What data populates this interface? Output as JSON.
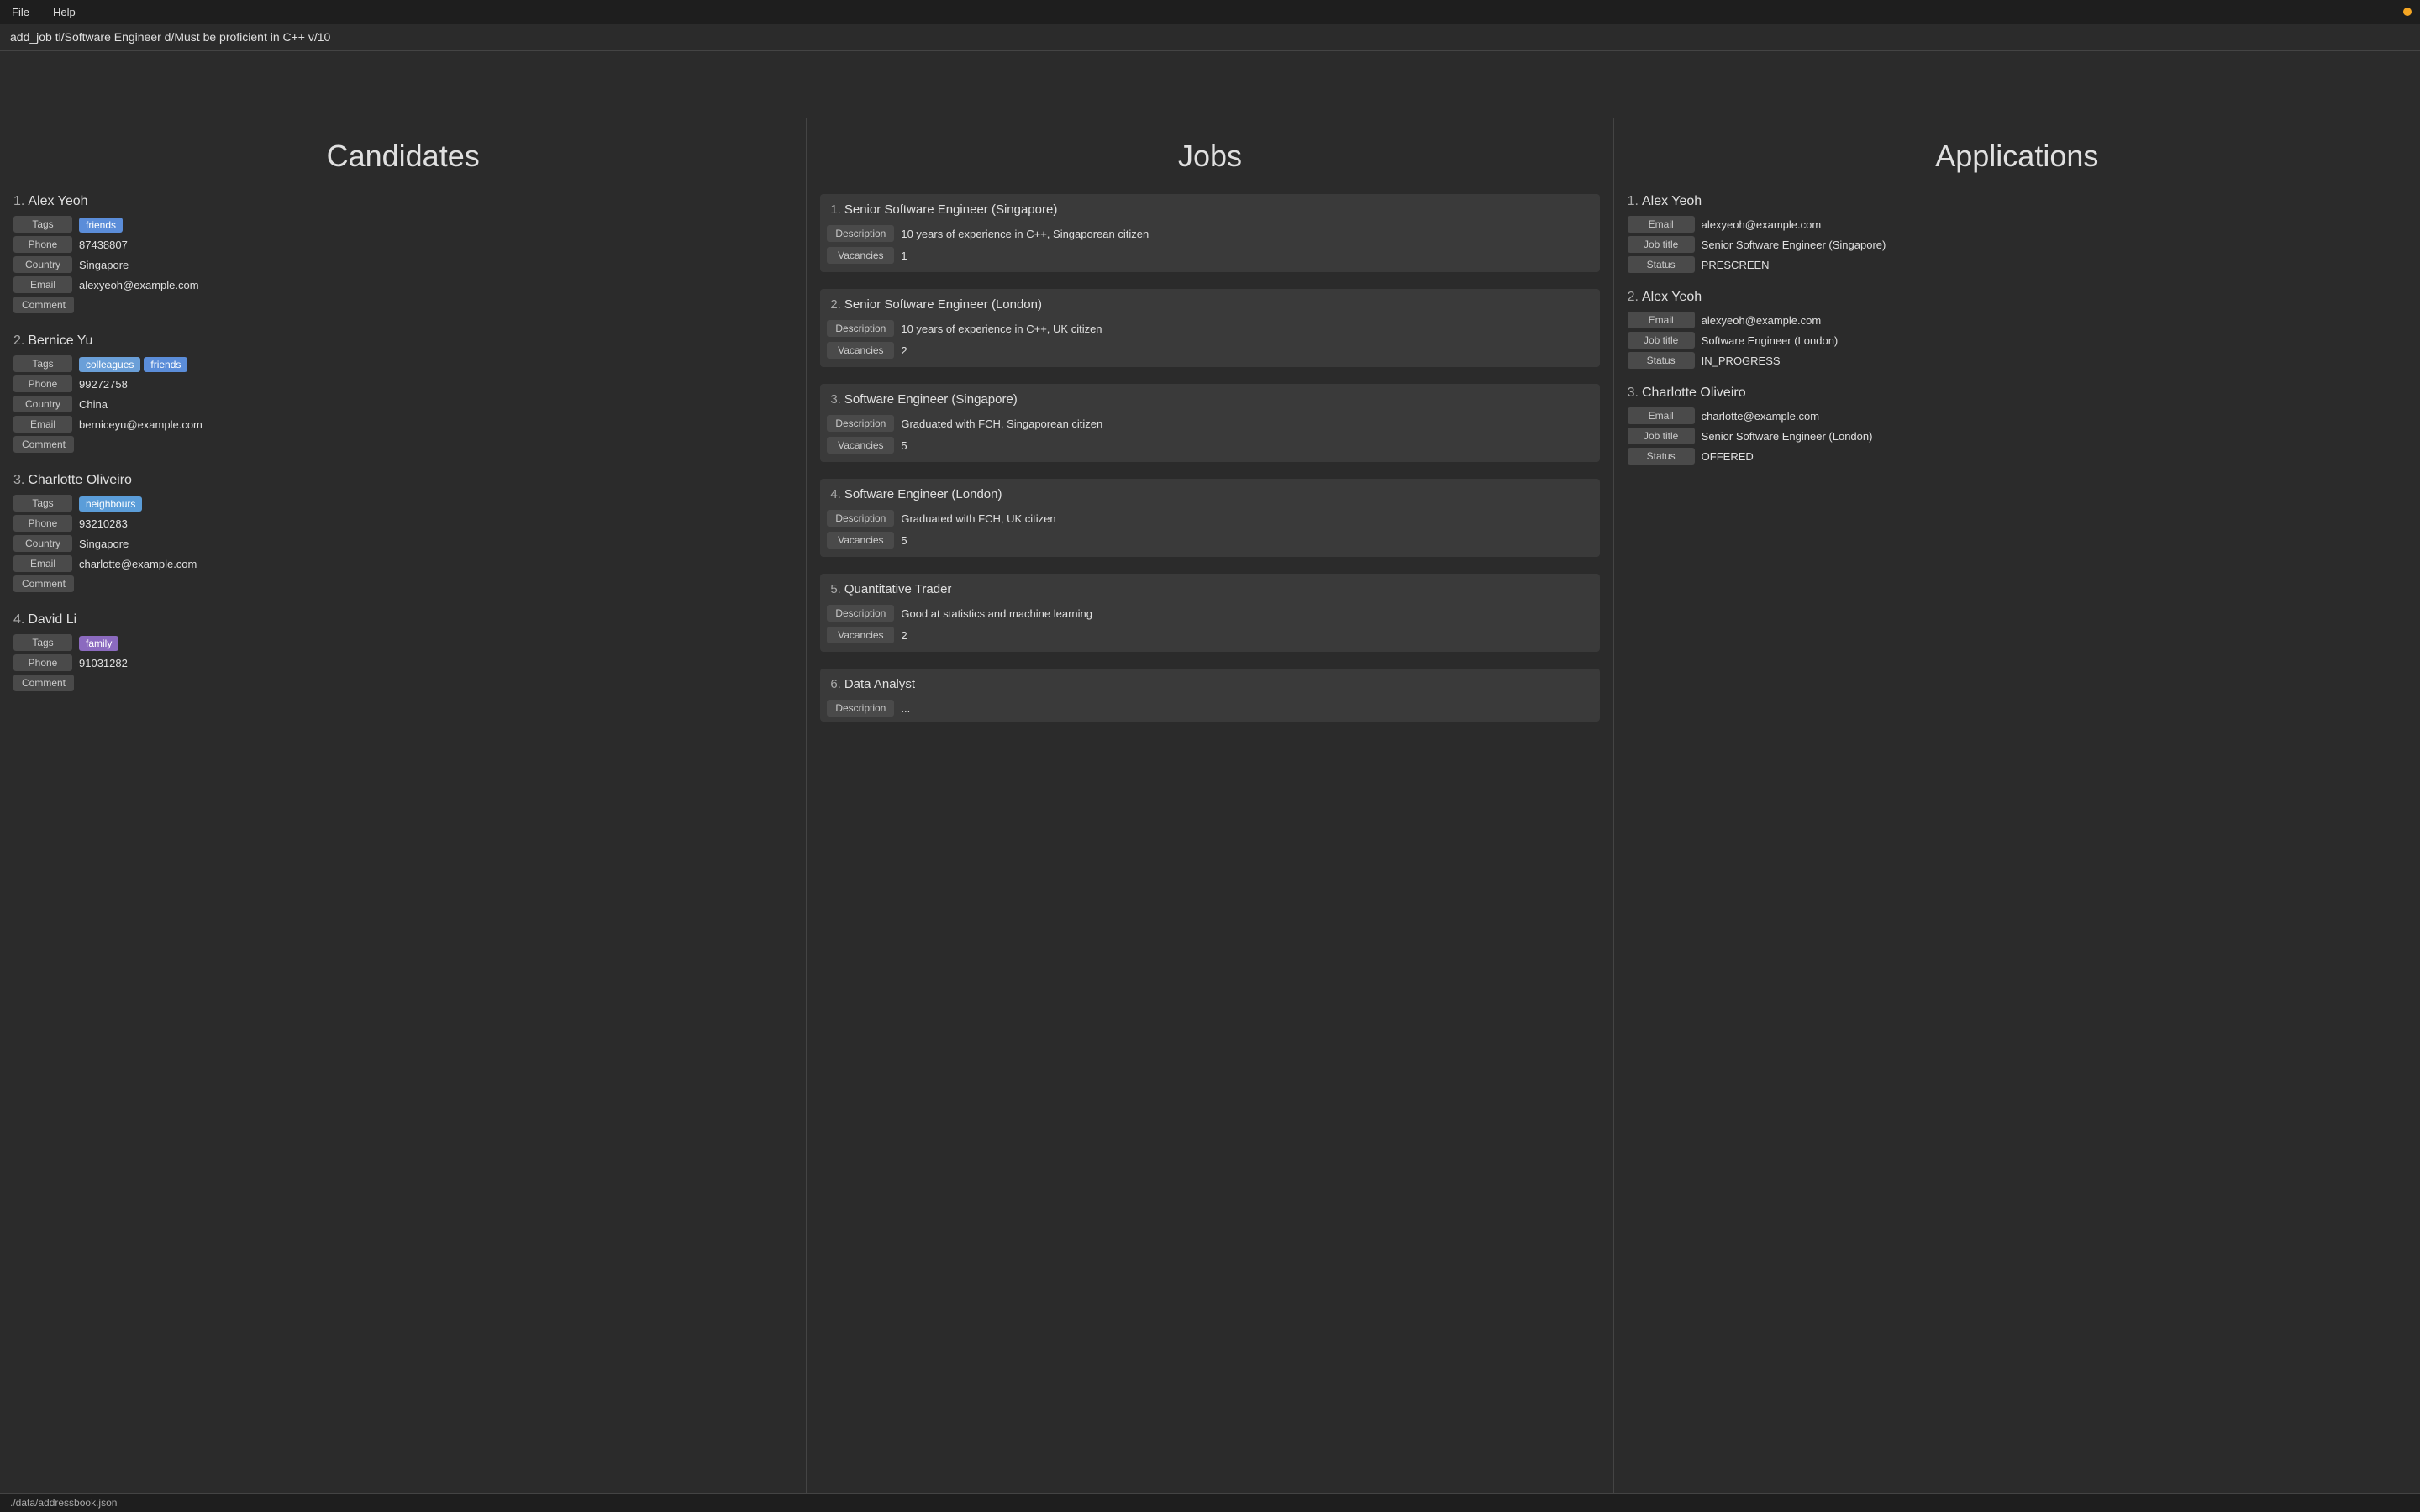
{
  "menubar": {
    "items": [
      "File",
      "Help"
    ]
  },
  "command": {
    "value": "add_job ti/Software Engineer d/Must be proficient in C++ v/10"
  },
  "columns": {
    "candidates": {
      "header": "Candidates",
      "items": [
        {
          "number": "1.",
          "name": "Alex Yeoh",
          "tags": [
            {
              "label": "friends",
              "type": "friends"
            }
          ],
          "phone": "87438807",
          "country": "Singapore",
          "email": "alexyeoh@example.com",
          "comment": ""
        },
        {
          "number": "2.",
          "name": "Bernice Yu",
          "tags": [
            {
              "label": "colleagues",
              "type": "colleagues"
            },
            {
              "label": "friends",
              "type": "friends"
            }
          ],
          "phone": "99272758",
          "country": "China",
          "email": "berniceyu@example.com",
          "comment": ""
        },
        {
          "number": "3.",
          "name": "Charlotte Oliveiro",
          "tags": [
            {
              "label": "neighbours",
              "type": "neighbours"
            }
          ],
          "phone": "93210283",
          "country": "Singapore",
          "email": "charlotte@example.com",
          "comment": ""
        },
        {
          "number": "4.",
          "name": "David Li",
          "tags": [
            {
              "label": "family",
              "type": "family"
            }
          ],
          "phone": "91031282",
          "country": "",
          "email": "",
          "comment": ""
        }
      ],
      "field_labels": {
        "tags": "Tags",
        "phone": "Phone",
        "country": "Country",
        "email": "Email",
        "comment": "Comment"
      }
    },
    "jobs": {
      "header": "Jobs",
      "items": [
        {
          "number": "1.",
          "title": "Senior Software Engineer (Singapore)",
          "description": "10 years of experience in C++, Singaporean citizen",
          "vacancies": "1"
        },
        {
          "number": "2.",
          "title": "Senior Software Engineer (London)",
          "description": "10 years of experience in C++, UK citizen",
          "vacancies": "2"
        },
        {
          "number": "3.",
          "title": "Software Engineer (Singapore)",
          "description": "Graduated with FCH, Singaporean citizen",
          "vacancies": "5"
        },
        {
          "number": "4.",
          "title": "Software Engineer (London)",
          "description": "Graduated with FCH, UK citizen",
          "vacancies": "5"
        },
        {
          "number": "5.",
          "title": "Quantitative Trader",
          "description": "Good at statistics and machine learning",
          "vacancies": "2"
        },
        {
          "number": "6.",
          "title": "Data Analyst",
          "description": "...",
          "vacancies": ""
        }
      ],
      "field_labels": {
        "description": "Description",
        "vacancies": "Vacancies"
      }
    },
    "applications": {
      "header": "Applications",
      "items": [
        {
          "number": "1.",
          "name": "Alex Yeoh",
          "email": "alexyeoh@example.com",
          "job_title": "Senior Software Engineer (Singapore)",
          "status": "PRESCREEN"
        },
        {
          "number": "2.",
          "name": "Alex Yeoh",
          "email": "alexyeoh@example.com",
          "job_title": "Software Engineer (London)",
          "status": "IN_PROGRESS"
        },
        {
          "number": "3.",
          "name": "Charlotte Oliveiro",
          "email": "charlotte@example.com",
          "job_title": "Senior Software Engineer (London)",
          "status": "OFFERED"
        }
      ],
      "field_labels": {
        "email": "Email",
        "job_title": "Job title",
        "status": "Status"
      }
    }
  },
  "statusbar": {
    "text": "./data/addressbook.json"
  }
}
